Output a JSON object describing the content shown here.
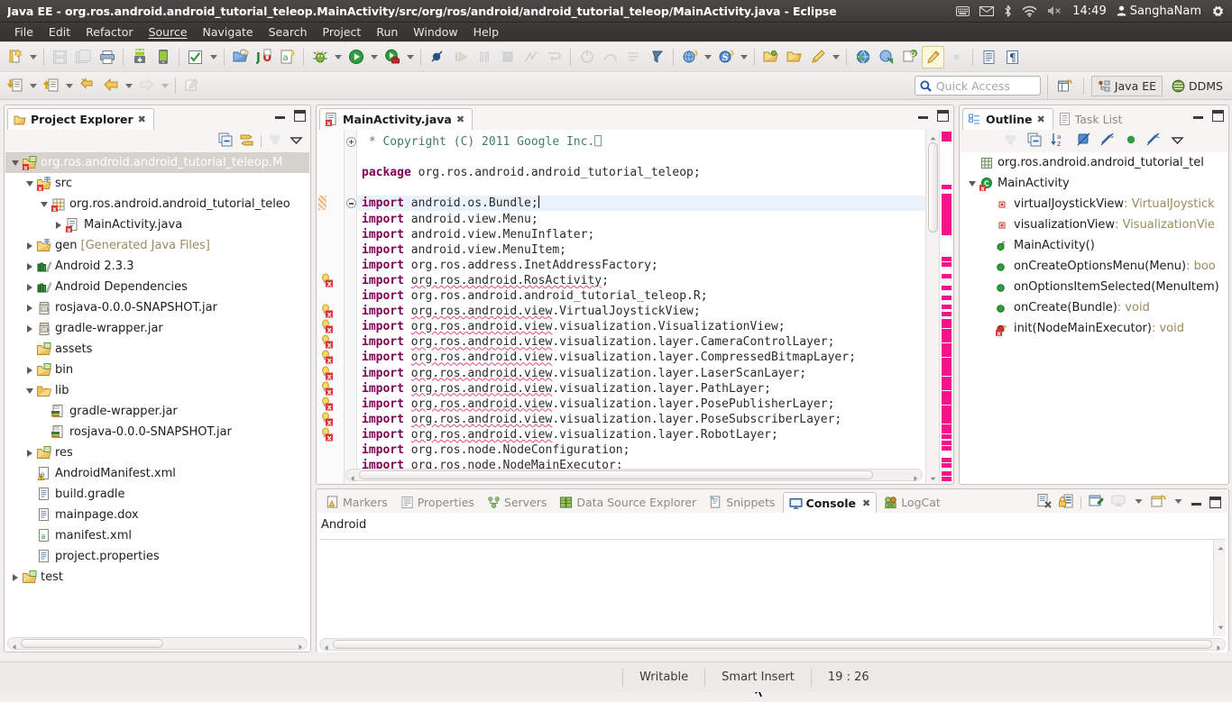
{
  "window": {
    "title": "Java EE - org.ros.android.android_tutorial_teleop.MainActivity/src/org/ros/android/android_tutorial_teleop/MainActivity.java - Eclipse"
  },
  "tray": {
    "icons": [
      "keyboard-icon",
      "mail-icon",
      "bluetooth-icon",
      "wifi-icon",
      "volume-muted-icon"
    ],
    "clock": "14:49",
    "user": "SanghaNam",
    "gear": "gear-icon"
  },
  "menubar": {
    "items": [
      "File",
      "Edit",
      "Refactor",
      "Source",
      "Navigate",
      "Search",
      "Project",
      "Run",
      "Window",
      "Help"
    ]
  },
  "quick_access": {
    "placeholder": "Quick Access",
    "icon": "search-icon"
  },
  "perspectives": {
    "new_perspective_icon": "new-perspective-icon",
    "items": [
      {
        "label": "Java EE",
        "active": true
      },
      {
        "label": "DDMS",
        "active": false
      }
    ]
  },
  "project_explorer": {
    "tab_label": "Project Explorer",
    "toolbar_icons": [
      "collapse-all-icon",
      "link-with-editor-icon",
      "focus-icon",
      "view-menu-icon"
    ],
    "tree": [
      {
        "indent": 0,
        "twisty": "open",
        "icon": "android-project-icon",
        "label": "org.ros.android.android_tutorial_teleop.M",
        "selected": true
      },
      {
        "indent": 1,
        "twisty": "open",
        "icon": "source-folder-icon",
        "label": "src"
      },
      {
        "indent": 2,
        "twisty": "open",
        "icon": "package-icon",
        "label": "org.ros.android.android_tutorial_teleo"
      },
      {
        "indent": 3,
        "twisty": "closed",
        "icon": "java-file-error-icon",
        "label": "MainActivity.java"
      },
      {
        "indent": 1,
        "twisty": "closed",
        "icon": "gen-folder-icon",
        "label": "gen",
        "sub": "[Generated Java Files]"
      },
      {
        "indent": 1,
        "twisty": "closed",
        "icon": "library-icon",
        "label": "Android 2.3.3"
      },
      {
        "indent": 1,
        "twisty": "closed",
        "icon": "library-icon",
        "label": "Android Dependencies"
      },
      {
        "indent": 1,
        "twisty": "closed",
        "icon": "jar-icon",
        "label": "rosjava-0.0.0-SNAPSHOT.jar"
      },
      {
        "indent": 1,
        "twisty": "closed",
        "icon": "jar-icon",
        "label": "gradle-wrapper.jar"
      },
      {
        "indent": 1,
        "twisty": "none",
        "icon": "folder-icon",
        "label": "assets"
      },
      {
        "indent": 1,
        "twisty": "closed",
        "icon": "folder-icon",
        "label": "bin"
      },
      {
        "indent": 1,
        "twisty": "open",
        "icon": "folder-open-icon",
        "label": "lib"
      },
      {
        "indent": 2,
        "twisty": "none",
        "icon": "jar-file-icon",
        "label": "gradle-wrapper.jar"
      },
      {
        "indent": 2,
        "twisty": "none",
        "icon": "jar-file-icon",
        "label": "rosjava-0.0.0-SNAPSHOT.jar"
      },
      {
        "indent": 1,
        "twisty": "closed",
        "icon": "folder-icon",
        "label": "res"
      },
      {
        "indent": 1,
        "twisty": "none",
        "icon": "xml-warning-icon",
        "label": "AndroidManifest.xml"
      },
      {
        "indent": 1,
        "twisty": "none",
        "icon": "file-icon",
        "label": "build.gradle"
      },
      {
        "indent": 1,
        "twisty": "none",
        "icon": "file-icon",
        "label": "mainpage.dox"
      },
      {
        "indent": 1,
        "twisty": "none",
        "icon": "xml-file-icon",
        "label": "manifest.xml"
      },
      {
        "indent": 1,
        "twisty": "none",
        "icon": "file-icon",
        "label": "project.properties"
      },
      {
        "indent": 0,
        "twisty": "closed",
        "icon": "folder-project-icon",
        "label": "test"
      }
    ]
  },
  "editor": {
    "tab_label": "MainActivity.java",
    "tab_icon": "java-file-error-icon",
    "lines": [
      {
        "fold": "plus",
        "marker": "",
        "segs": [
          {
            "t": " * Copyright (C) 2011 Google Inc.",
            "c": "cmt"
          },
          {
            "t": "⎕",
            "c": "cmt"
          }
        ]
      },
      {
        "fold": "",
        "marker": "",
        "segs": []
      },
      {
        "fold": "",
        "marker": "",
        "segs": [
          {
            "t": "package",
            "c": "kw"
          },
          {
            "t": " org.ros.android.android_tutorial_teleop;",
            "c": ""
          }
        ]
      },
      {
        "fold": "",
        "marker": "",
        "segs": []
      },
      {
        "fold": "minus",
        "marker": "change",
        "hl": true,
        "segs": [
          {
            "t": "import",
            "c": "kw"
          },
          {
            "t": " android.os.Bundle;",
            "c": ""
          }
        ]
      },
      {
        "fold": "",
        "marker": "",
        "segs": [
          {
            "t": "import",
            "c": "kw"
          },
          {
            "t": " android.view.Menu;",
            "c": ""
          }
        ]
      },
      {
        "fold": "",
        "marker": "",
        "segs": [
          {
            "t": "import",
            "c": "kw"
          },
          {
            "t": " android.view.MenuInflater;",
            "c": ""
          }
        ]
      },
      {
        "fold": "",
        "marker": "",
        "segs": [
          {
            "t": "import",
            "c": "kw"
          },
          {
            "t": " android.view.MenuItem;",
            "c": ""
          }
        ]
      },
      {
        "fold": "",
        "marker": "",
        "segs": [
          {
            "t": "import",
            "c": "kw"
          },
          {
            "t": " org.ros.address.InetAddressFactory;",
            "c": ""
          }
        ]
      },
      {
        "fold": "",
        "marker": "error",
        "segs": [
          {
            "t": "import",
            "c": "kw"
          },
          {
            "t": " ",
            "c": ""
          },
          {
            "t": "org.ros.android.RosActivity",
            "c": "err"
          },
          {
            "t": ";",
            "c": ""
          }
        ]
      },
      {
        "fold": "",
        "marker": "",
        "segs": [
          {
            "t": "import",
            "c": "kw"
          },
          {
            "t": " org.ros.android.android_tutorial_teleop.R;",
            "c": ""
          }
        ]
      },
      {
        "fold": "",
        "marker": "error",
        "segs": [
          {
            "t": "import",
            "c": "kw"
          },
          {
            "t": " ",
            "c": ""
          },
          {
            "t": "org.ros.android.view",
            "c": "err"
          },
          {
            "t": ".VirtualJoystickView;",
            "c": ""
          }
        ]
      },
      {
        "fold": "",
        "marker": "error",
        "segs": [
          {
            "t": "import",
            "c": "kw"
          },
          {
            "t": " ",
            "c": ""
          },
          {
            "t": "org.ros.android.view",
            "c": "err"
          },
          {
            "t": ".visualization.VisualizationView;",
            "c": ""
          }
        ]
      },
      {
        "fold": "",
        "marker": "error",
        "segs": [
          {
            "t": "import",
            "c": "kw"
          },
          {
            "t": " ",
            "c": ""
          },
          {
            "t": "org.ros.android.view",
            "c": "err"
          },
          {
            "t": ".visualization.layer.CameraControlLayer;",
            "c": ""
          }
        ]
      },
      {
        "fold": "",
        "marker": "error",
        "segs": [
          {
            "t": "import",
            "c": "kw"
          },
          {
            "t": " ",
            "c": ""
          },
          {
            "t": "org.ros.android.view",
            "c": "err"
          },
          {
            "t": ".visualization.layer.CompressedBitmapLayer;",
            "c": ""
          }
        ]
      },
      {
        "fold": "",
        "marker": "error",
        "segs": [
          {
            "t": "import",
            "c": "kw"
          },
          {
            "t": " ",
            "c": ""
          },
          {
            "t": "org.ros.android.view",
            "c": "err"
          },
          {
            "t": ".visualization.layer.LaserScanLayer;",
            "c": ""
          }
        ]
      },
      {
        "fold": "",
        "marker": "error",
        "segs": [
          {
            "t": "import",
            "c": "kw"
          },
          {
            "t": " ",
            "c": ""
          },
          {
            "t": "org.ros.android.view",
            "c": "err"
          },
          {
            "t": ".visualization.layer.PathLayer;",
            "c": ""
          }
        ]
      },
      {
        "fold": "",
        "marker": "error",
        "segs": [
          {
            "t": "import",
            "c": "kw"
          },
          {
            "t": " ",
            "c": ""
          },
          {
            "t": "org.ros.android.view",
            "c": "err"
          },
          {
            "t": ".visualization.layer.PosePublisherLayer;",
            "c": ""
          }
        ]
      },
      {
        "fold": "",
        "marker": "error",
        "segs": [
          {
            "t": "import",
            "c": "kw"
          },
          {
            "t": " ",
            "c": ""
          },
          {
            "t": "org.ros.android.view",
            "c": "err"
          },
          {
            "t": ".visualization.layer.PoseSubscriberLayer;",
            "c": ""
          }
        ]
      },
      {
        "fold": "",
        "marker": "error",
        "segs": [
          {
            "t": "import",
            "c": "kw"
          },
          {
            "t": " ",
            "c": ""
          },
          {
            "t": "org.ros.android.view",
            "c": "err"
          },
          {
            "t": ".visualization.layer.RobotLayer;",
            "c": ""
          }
        ]
      },
      {
        "fold": "",
        "marker": "",
        "segs": [
          {
            "t": "import",
            "c": "kw"
          },
          {
            "t": " org.ros.node.NodeConfiguration;",
            "c": ""
          }
        ]
      },
      {
        "fold": "",
        "marker": "",
        "clip": true,
        "segs": [
          {
            "t": "import",
            "c": "kw"
          },
          {
            "t": " org.ros.node.NodeMainExecutor;",
            "c": ""
          }
        ]
      }
    ]
  },
  "outline": {
    "tabs": [
      {
        "label": "Outline",
        "icon": "outline-icon",
        "active": true
      },
      {
        "label": "Task List",
        "icon": "tasklist-icon",
        "active": false
      }
    ],
    "toolbar_icons": [
      "focus-icon",
      "collapse-all-icon",
      "sort-az-icon",
      "hide-fields-icon",
      "hide-static-icon",
      "hide-nonpublic-icon",
      "hide-local-icon",
      "view-menu-icon"
    ],
    "items": [
      {
        "indent": 0,
        "twisty": "none",
        "icon": "package-outline-icon",
        "label": "org.ros.android.android_tutorial_tel",
        "type": ""
      },
      {
        "indent": 0,
        "twisty": "open",
        "icon": "class-error-icon",
        "label": "MainActivity",
        "type": ""
      },
      {
        "indent": 1,
        "twisty": "none",
        "icon": "field-private-icon",
        "label": "virtualJoystickView",
        "type": " : VirtualJoystick"
      },
      {
        "indent": 1,
        "twisty": "none",
        "icon": "field-private-icon",
        "label": "visualizationView",
        "type": " : VisualizationVie"
      },
      {
        "indent": 1,
        "twisty": "none",
        "icon": "constructor-icon",
        "label": "MainActivity()",
        "type": ""
      },
      {
        "indent": 1,
        "twisty": "none",
        "icon": "method-public-icon",
        "label": "onCreateOptionsMenu(Menu)",
        "type": " : boo"
      },
      {
        "indent": 1,
        "twisty": "none",
        "icon": "method-public-icon",
        "label": "onOptionsItemSelected(MenuItem)",
        "type": ""
      },
      {
        "indent": 1,
        "twisty": "none",
        "icon": "method-public-icon",
        "label": "onCreate(Bundle)",
        "type": " : void"
      },
      {
        "indent": 1,
        "twisty": "none",
        "icon": "method-error-icon",
        "label": "init(NodeMainExecutor)",
        "type": " : void"
      }
    ]
  },
  "console": {
    "tabs": [
      {
        "label": "Markers",
        "icon": "markers-icon",
        "active": false
      },
      {
        "label": "Properties",
        "icon": "properties-icon",
        "active": false
      },
      {
        "label": "Servers",
        "icon": "servers-icon",
        "active": false
      },
      {
        "label": "Data Source Explorer",
        "icon": "datasource-icon",
        "active": false
      },
      {
        "label": "Snippets",
        "icon": "snippets-icon",
        "active": false
      },
      {
        "label": "Console",
        "icon": "console-icon",
        "active": true
      },
      {
        "label": "LogCat",
        "icon": "logcat-icon",
        "active": false
      }
    ],
    "toolbar_icons": [
      "clear-console-icon",
      "scroll-lock-icon",
      "pin-console-icon",
      "display-console-icon",
      "display-console-menu-icon",
      "open-console-icon",
      "open-console-menu-icon"
    ],
    "content_label": "Android",
    "output": ""
  },
  "statusbar": {
    "writable": "Writable",
    "insert_mode": "Smart Insert",
    "position": "19 : 26"
  },
  "colors": {
    "titlebar": "#413e3b",
    "accent_selection": "#d6d3ce",
    "keyword": "#7f0055",
    "comment": "#3f7f5f",
    "error_marker": "#f3148c",
    "link_text": "#2b5c8a"
  }
}
